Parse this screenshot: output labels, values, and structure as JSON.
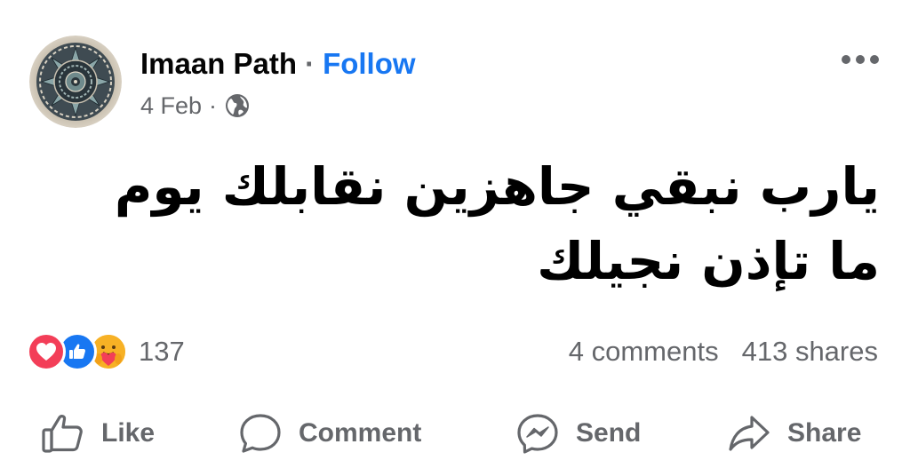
{
  "post": {
    "author": "Imaan Path",
    "separator": "·",
    "follow_label": "Follow",
    "date": "4 Feb",
    "date_separator": "·",
    "audience_icon": "globe-icon",
    "menu_icon": "more-options-icon",
    "text": "يارب نبقي جاهزين نقابلك يوم ما تإذن نجيلك"
  },
  "stats": {
    "reactions": [
      "love",
      "like",
      "care"
    ],
    "reaction_count": "137",
    "comments": "4 comments",
    "shares": "413 shares"
  },
  "actions": {
    "like": "Like",
    "comment": "Comment",
    "send": "Send",
    "share": "Share"
  },
  "colors": {
    "link_blue": "#1877f2",
    "secondary_text": "#65676b",
    "love_red": "#f33e58",
    "care_yellow": "#f7b125"
  }
}
